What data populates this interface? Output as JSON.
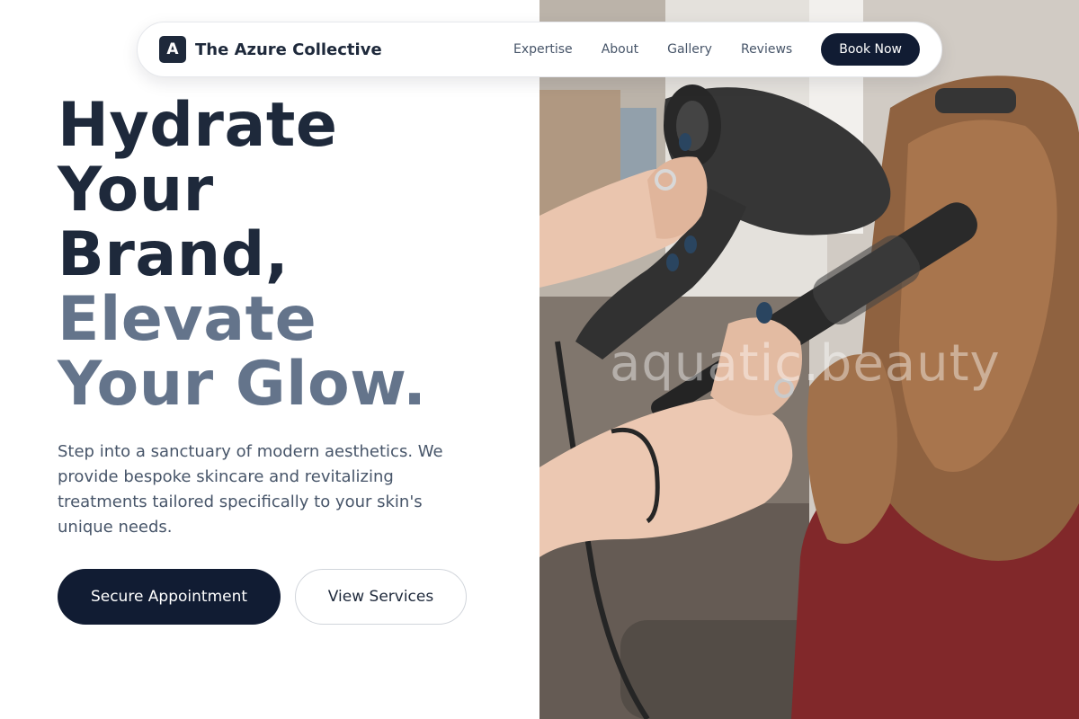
{
  "nav": {
    "brand_mark": "A",
    "brand_name": "The Azure Collective",
    "links": [
      "Expertise",
      "About",
      "Gallery",
      "Reviews"
    ],
    "cta": "Book Now"
  },
  "hero": {
    "headline_dark": [
      "Hydrate",
      "Your",
      "Brand,"
    ],
    "headline_muted": [
      "Elevate",
      "Your Glow."
    ],
    "lead": "Step into a sanctuary of modern aesthetics. We provide bespoke skincare and revitalizing treatments tailored specifically to your skin's unique needs.",
    "primary_cta": "Secure Appointment",
    "secondary_cta": "View Services"
  },
  "image": {
    "watermark": "aquatic.beauty",
    "subject_icon": "hair-styling-photo-icon"
  },
  "colors": {
    "navy": "#111c33",
    "slate_dark": "#1e293b",
    "slate_muted": "#64748b",
    "body_text": "#475569"
  }
}
